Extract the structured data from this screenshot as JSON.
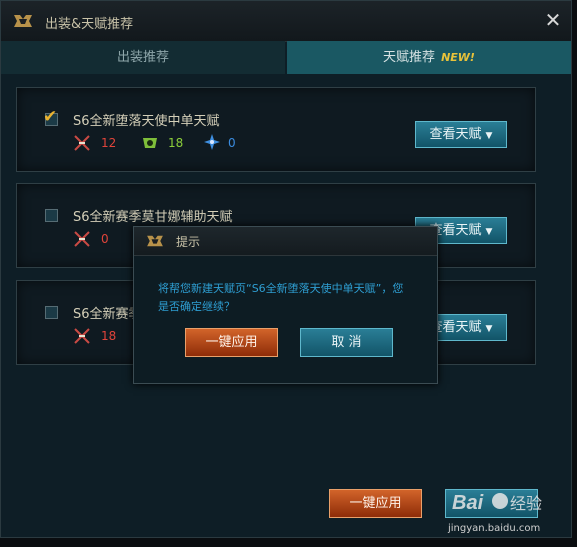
{
  "window": {
    "title": "出装&天赋推荐"
  },
  "tabs": [
    {
      "label": "出装推荐"
    },
    {
      "label": "天赋推荐",
      "badge": "NEW!"
    }
  ],
  "pages": [
    {
      "name": "S6全新堕落天使中单天赋",
      "checked": true,
      "attack": "12",
      "defense": "18",
      "utility": "0",
      "button": "查看天赋"
    },
    {
      "name": "S6全新赛季莫甘娜辅助天赋",
      "checked": false,
      "attack": "0",
      "defense": "",
      "utility": "",
      "button": "查看天赋"
    },
    {
      "name": "S6全新赛季",
      "checked": false,
      "attack": "18",
      "defense": "",
      "utility": "",
      "button": "查看天赋"
    }
  ],
  "dialog": {
    "title": "提示",
    "message": "将帮您新建天赋页“S6全新堕落天使中单天赋”，您是否确定继续？",
    "confirm": "一键应用",
    "cancel": "取 消"
  },
  "footer": {
    "apply": "一键应用"
  },
  "watermark": {
    "text": "jingyan.baidu.com"
  },
  "colors": {
    "attack": "#e0443a",
    "defense": "#8ccf3a",
    "utility": "#3a8ce0",
    "accent": "#e8b230"
  }
}
